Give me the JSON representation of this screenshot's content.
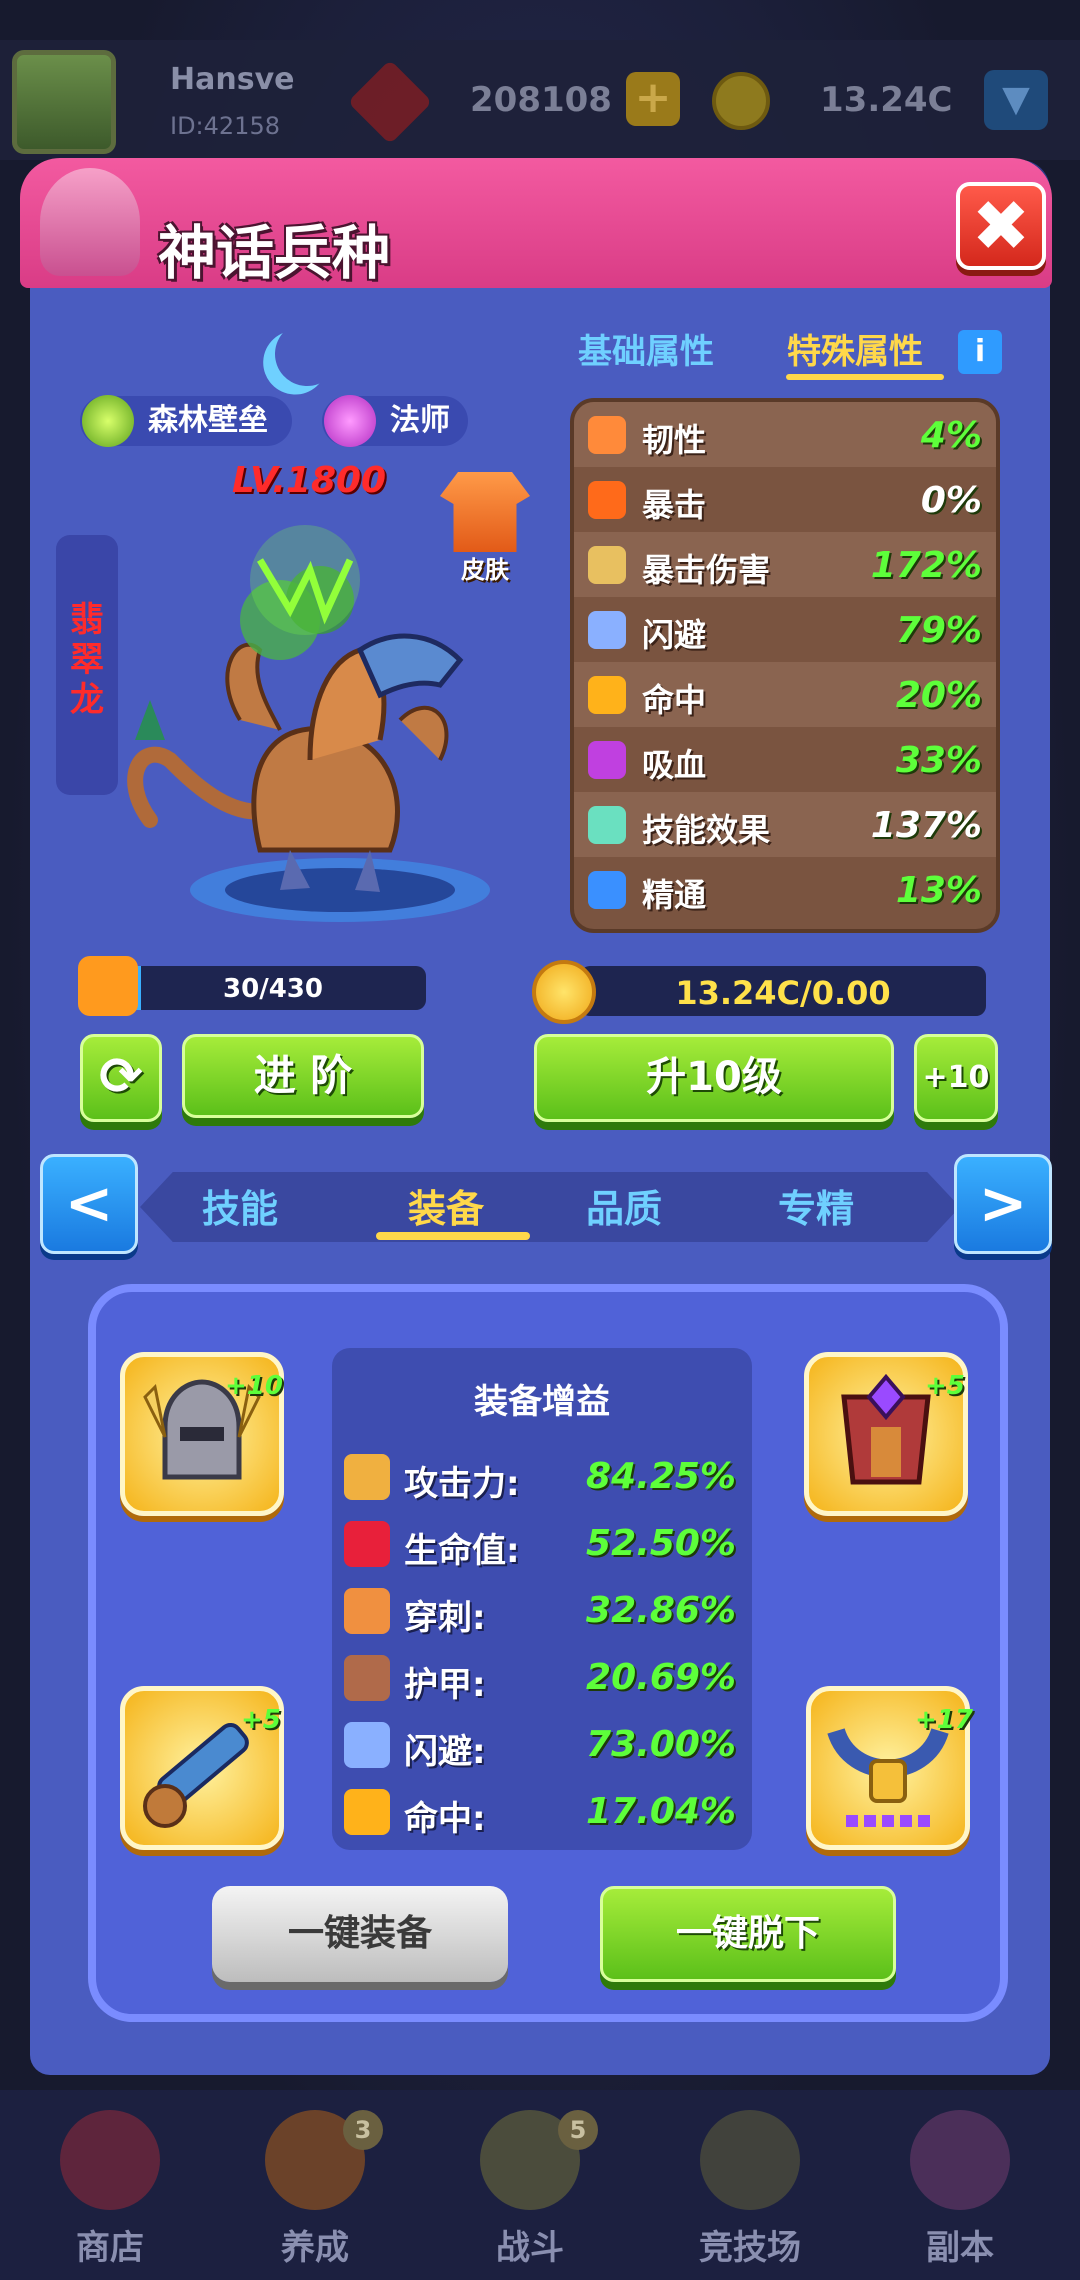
{
  "topbar": {
    "username": "Hansve",
    "user_id": "ID:42158",
    "gems": "208108",
    "plus": "+",
    "coins": "13.24C",
    "dropdown": "▼"
  },
  "panel": {
    "title": "神话兵种",
    "close": "✖"
  },
  "hero": {
    "faction": "森林壁垒",
    "class": "法师",
    "level": "LV.1800",
    "skin_label": "皮肤",
    "name": "翡翠龙"
  },
  "attr_tabs": {
    "basic": "基础属性",
    "special": "特殊属性",
    "info": "i"
  },
  "stats": [
    {
      "label": "韧性",
      "value": "4%",
      "color": "#5dff3a",
      "icon_color": "#ff8a3a"
    },
    {
      "label": "暴击",
      "value": "0%",
      "color": "#ffffff",
      "icon_color": "#ff6a1a"
    },
    {
      "label": "暴击伤害",
      "value": "172%",
      "color": "#5dff3a",
      "icon_color": "#e8c060"
    },
    {
      "label": "闪避",
      "value": "79%",
      "color": "#5dff3a",
      "icon_color": "#8ab0ff"
    },
    {
      "label": "命中",
      "value": "20%",
      "color": "#5dff3a",
      "icon_color": "#ffb21a"
    },
    {
      "label": "吸血",
      "value": "33%",
      "color": "#5dff3a",
      "icon_color": "#c040e0"
    },
    {
      "label": "技能效果",
      "value": "137%",
      "color": "#ffffff",
      "icon_color": "#6ae0c0"
    },
    {
      "label": "精通",
      "value": "13%",
      "color": "#5dff3a",
      "icon_color": "#3a90ff"
    }
  ],
  "shards": {
    "text": "30/430",
    "current": 30,
    "max": 430
  },
  "gold": {
    "text": "13.24C/0.00"
  },
  "buttons": {
    "refresh": "⟳",
    "advance": "进 阶",
    "level_up": "升10级",
    "plus10": "+10",
    "equip_all": "一键装备",
    "unequip_all": "一键脱下"
  },
  "sub_tabs": {
    "prev": "<",
    "next": ">",
    "items": [
      "技能",
      "装备",
      "品质",
      "专精"
    ],
    "active": "装备"
  },
  "equipment": {
    "slots": [
      {
        "slot": "helmet",
        "level": "+10"
      },
      {
        "slot": "armor",
        "level": "+5"
      },
      {
        "slot": "weapon",
        "level": "+5"
      },
      {
        "slot": "necklace",
        "level": "+17"
      }
    ],
    "boost_title": "装备增益",
    "boosts": [
      {
        "label": "攻击力:",
        "value": "84.25%",
        "icon_color": "#f0b040"
      },
      {
        "label": "生命值:",
        "value": "52.50%",
        "icon_color": "#e8203a"
      },
      {
        "label": "穿刺:",
        "value": "32.86%",
        "icon_color": "#f09040"
      },
      {
        "label": "护甲:",
        "value": "20.69%",
        "icon_color": "#b06a4a"
      },
      {
        "label": "闪避:",
        "value": "73.00%",
        "icon_color": "#8ab0ff"
      },
      {
        "label": "命中:",
        "value": "17.04%",
        "icon_color": "#ffb21a"
      }
    ]
  },
  "bottom_nav": [
    {
      "label": "商店",
      "badge": ""
    },
    {
      "label": "养成",
      "badge": "3"
    },
    {
      "label": "战斗",
      "badge": "5"
    },
    {
      "label": "竞技场",
      "badge": ""
    },
    {
      "label": "副本",
      "badge": ""
    }
  ]
}
